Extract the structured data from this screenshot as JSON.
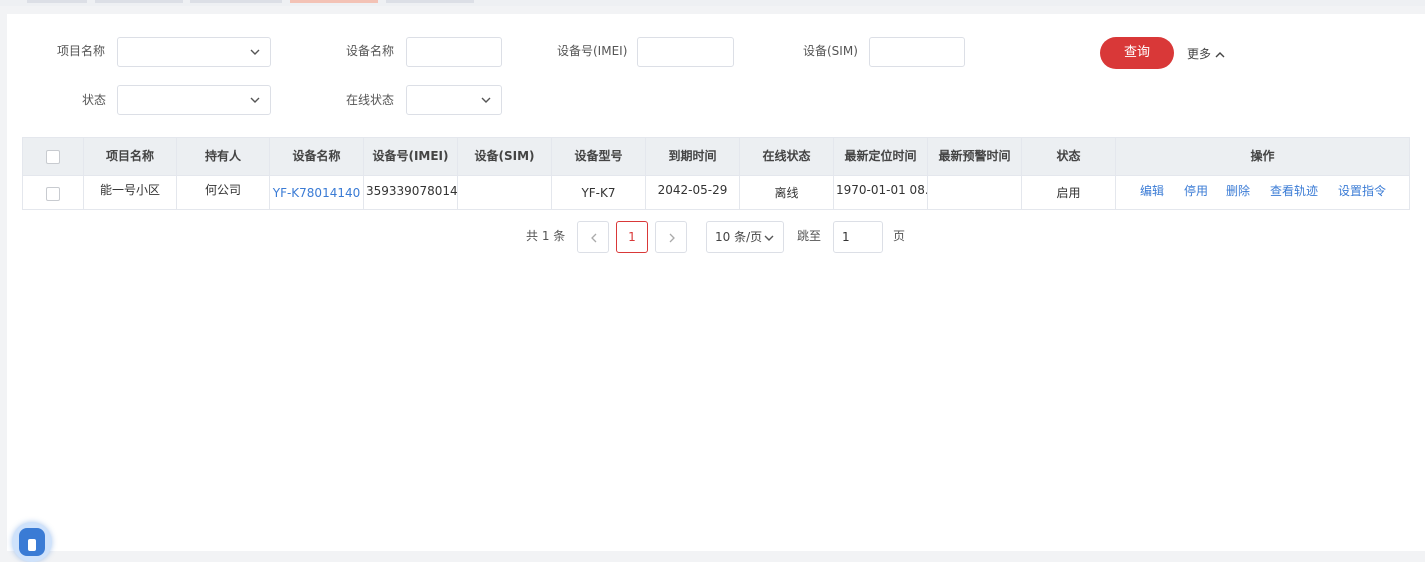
{
  "search": {
    "project_name_label": "项目名称",
    "device_name_label": "设备名称",
    "imei_label": "设备号(IMEI)",
    "sim_label": "设备(SIM)",
    "status_label": "状态",
    "online_status_label": "在线状态",
    "query_button": "查询",
    "more_label": "更多"
  },
  "table": {
    "headers": [
      "项目名称",
      "持有人",
      "设备名称",
      "设备号(IMEI)",
      "设备(SIM)",
      "设备型号",
      "到期时间",
      "在线状态",
      "最新定位时间",
      "最新预警时间",
      "状态",
      "操作"
    ],
    "rows": [
      {
        "project": "能一号小区",
        "owner": "何公司",
        "device_name": "YF-K78014140",
        "imei": "359339078014...",
        "sim": "",
        "model": "YF-K7",
        "expire": "2042-05-29",
        "online": "离线",
        "last_location": "1970-01-01 08...",
        "last_alert": "",
        "status": "启用",
        "actions": [
          "编辑",
          "停用",
          "删除",
          "查看轨迹",
          "设置指令"
        ]
      }
    ]
  },
  "pagination": {
    "total": "共 1 条",
    "current_page": "1",
    "page_size": "10 条/页",
    "jump_label": "跳至",
    "jump_value": "1",
    "page_suffix": "页"
  },
  "icons": {
    "dropdown": "chevron-down-icon",
    "collapse": "chevron-up-icon",
    "prev": "chevron-left-icon",
    "next": "chevron-right-icon"
  },
  "colors": {
    "primary": "#d93838",
    "link": "#3a7bd5"
  }
}
